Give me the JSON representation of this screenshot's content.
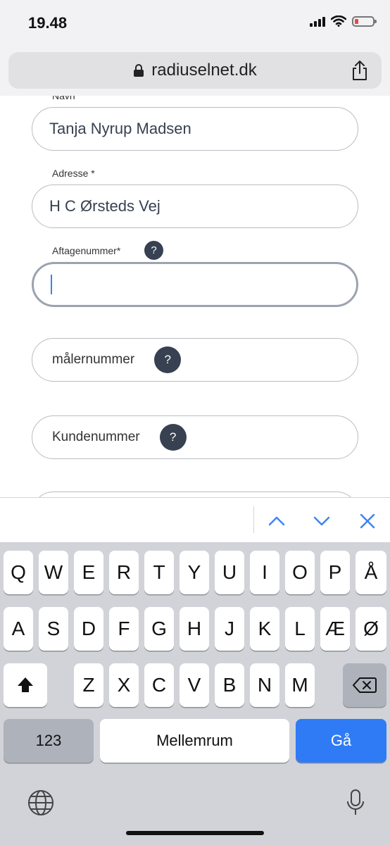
{
  "status": {
    "time": "19.48"
  },
  "browser": {
    "url": "radiuselnet.dk"
  },
  "form": {
    "name_label": "Navn",
    "name_value": "Tanja Nyrup Madsen",
    "address_label": "Adresse  *",
    "address_value": "H C Ørsteds Vej",
    "aftagenummer_label": "Aftagenummer*",
    "aftagenummer_value": "",
    "malernummer_placeholder": "målernummer",
    "kundenummer_placeholder": "Kundenummer",
    "help_glyph": "?"
  },
  "keyboard": {
    "row1": [
      "Q",
      "W",
      "E",
      "R",
      "T",
      "Y",
      "U",
      "I",
      "O",
      "P",
      "Å"
    ],
    "row2": [
      "A",
      "S",
      "D",
      "F",
      "G",
      "H",
      "J",
      "K",
      "L",
      "Æ",
      "Ø"
    ],
    "row3": [
      "Z",
      "X",
      "C",
      "V",
      "B",
      "N",
      "M"
    ],
    "numbers_label": "123",
    "space_label": "Mellemrum",
    "go_label": "Gå"
  },
  "colors": {
    "go_key": "#2f7bf5",
    "accent_icons": "#3b82f6",
    "help_badge": "#374151"
  }
}
